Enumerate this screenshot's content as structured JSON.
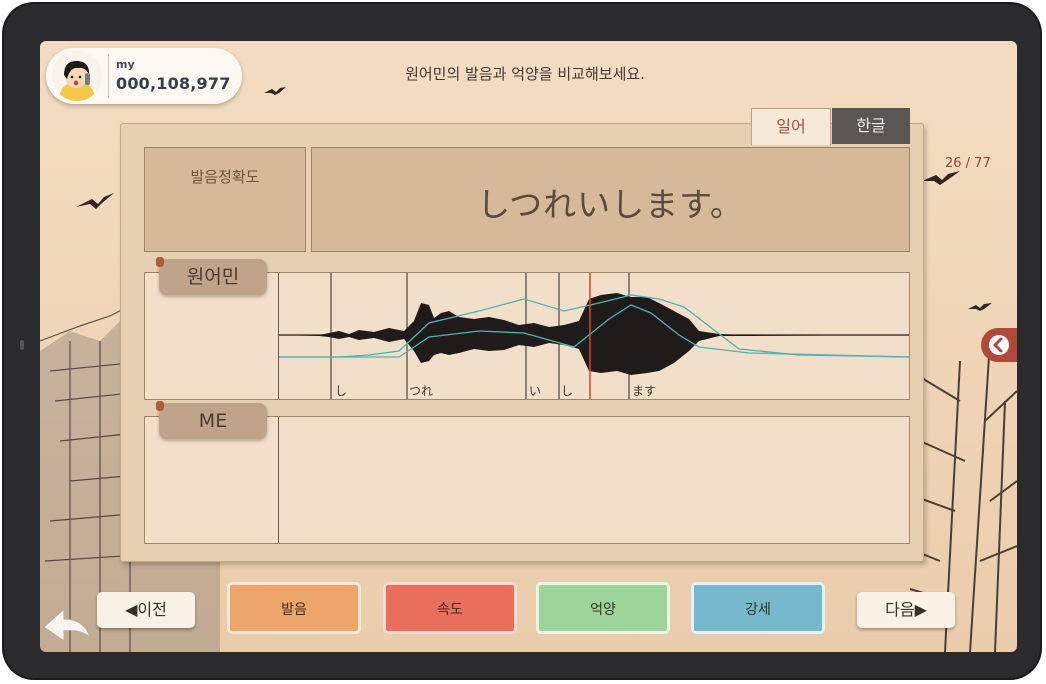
{
  "profile": {
    "my_label": "my",
    "score": "000,108,977"
  },
  "instruction": "원어민의 발음과 억양을 비교해보세요.",
  "counter": "26 / 77",
  "tabs": [
    {
      "label": "일어",
      "active": true
    },
    {
      "label": "한글",
      "active": false
    }
  ],
  "accuracy_label": "발음정확도",
  "sentence": "しつれいします。",
  "native": {
    "label": "원어민",
    "segments": [
      "し",
      "つれ",
      "い",
      "し",
      "ます"
    ]
  },
  "me": {
    "label": "ME"
  },
  "buttons": {
    "pronunciation": "발음",
    "speed": "속도",
    "intonation": "억양",
    "stress": "강세"
  },
  "nav": {
    "prev": "◀이전",
    "next": "다음▶"
  },
  "colors": {
    "pronunciation": "#eda56c",
    "speed": "#e76f5b",
    "intonation": "#9cd49a",
    "stress": "#77b9cc",
    "tab_active_text": "#b24a36",
    "cursor": "#e0442b"
  }
}
